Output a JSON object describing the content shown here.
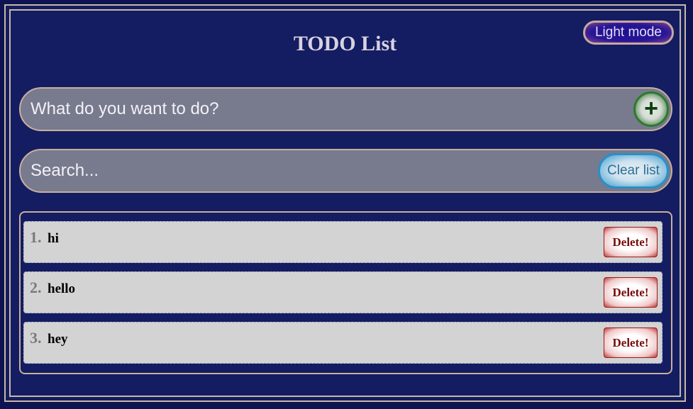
{
  "header": {
    "title": "TODO List",
    "mode_toggle_label": "Light mode"
  },
  "add_form": {
    "placeholder": "What do you want to do?",
    "add_button_label": "+"
  },
  "search_form": {
    "placeholder": "Search...",
    "clear_button_label": "Clear list"
  },
  "todos": [
    {
      "number": "1.",
      "text": "hi",
      "delete_label": "Delete!"
    },
    {
      "number": "2.",
      "text": "hello",
      "delete_label": "Delete!"
    },
    {
      "number": "3.",
      "text": "hey",
      "delete_label": "Delete!"
    }
  ],
  "colors": {
    "background": "#141d62",
    "border": "#c9b09c",
    "input_bg": "#787a8e",
    "item_bg": "#d3d3d3",
    "add_accent": "#2e7a2e",
    "clear_accent": "#2a8fc4",
    "delete_accent": "#9a1a1a"
  },
  "icons": {
    "add": "plus-icon"
  }
}
